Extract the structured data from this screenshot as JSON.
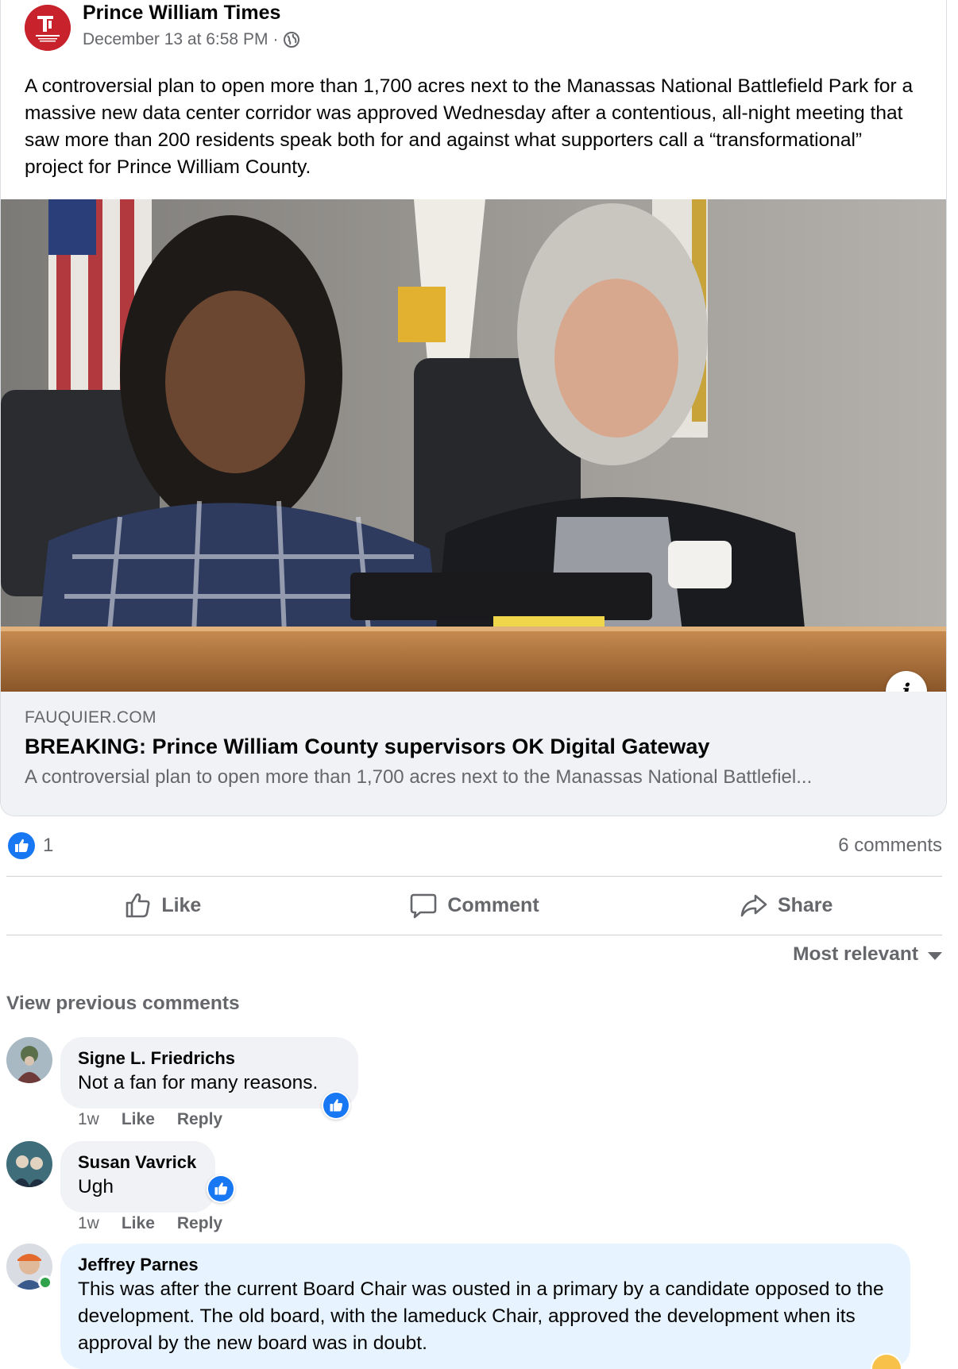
{
  "post": {
    "page_name": "Prince William Times",
    "timestamp": "December 13 at 6:58 PM",
    "separator": "·",
    "audience_icon": "globe-icon",
    "text": "A controversial plan to open more than 1,700 acres next to the Manassas National Battlefield Park for a massive new data center corridor was approved Wednesday after a contentious, all-night meeting that saw more than 200 residents speak both for and against what supporters call a “transformational” project for Prince William County."
  },
  "link": {
    "domain": "FAUQUIER.COM",
    "title": "BREAKING: Prince William County supervisors OK Digital Gateway",
    "description": "A controversial plan to open more than 1,700 acres next to the Manassas National Battlefield Park for a massive new data center corridor was approved Wednesday after a contentious, all-night meeting...",
    "description_shown": "A controversial plan to open more than 1,700 acres next to the Manassas National Battlefiel...",
    "info_label": "i"
  },
  "stats": {
    "reaction_count": "1",
    "comments_label": "6 comments"
  },
  "actions": {
    "like": "Like",
    "comment": "Comment",
    "share": "Share"
  },
  "sort": {
    "label": "Most relevant"
  },
  "view_previous": "View previous comments",
  "comments": [
    {
      "author": "Signe L. Friedrichs",
      "text": "Not a fan for many reasons.",
      "age": "1w",
      "like_label": "Like",
      "reply_label": "Reply"
    },
    {
      "author": "Susan Vavrick",
      "text": "Ugh",
      "age": "1w",
      "like_label": "Like",
      "reply_label": "Reply"
    },
    {
      "author": "Jeffrey Parnes",
      "text": "This was after the current Board Chair was ousted in a primary by a candidate opposed to the development. The old board, with the lameduck Chair, approved the development when its approval by the new board was in doubt."
    }
  ],
  "colors": {
    "brand_blue": "#1877f2",
    "secondary_text": "#65676b",
    "bubble_bg": "#f0f2f5",
    "highlight_bubble_bg": "#e7f3ff",
    "page_avatar_red": "#c8232c"
  }
}
